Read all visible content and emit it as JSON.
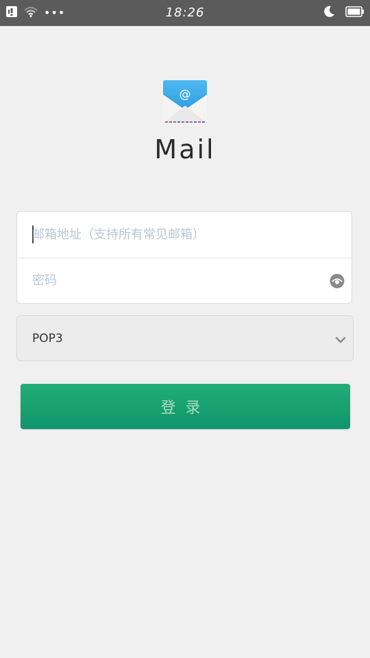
{
  "status_bar": {
    "time": "18:26",
    "dots": "•••",
    "icons": [
      "notification-icon",
      "wifi-icon",
      "more-dots-icon",
      "moon-icon",
      "battery-icon"
    ]
  },
  "app": {
    "icon": "mail-envelope-icon",
    "title": "Mail"
  },
  "form": {
    "email_placeholder": "邮箱地址（支持所有常见邮箱）",
    "email_value": "",
    "password_placeholder": "密码",
    "password_value": "",
    "show_password_icon": "eye-icon"
  },
  "protocol": {
    "selected": "POP3",
    "icon": "chevron-down-icon"
  },
  "login_button": {
    "label": "登录"
  },
  "colors": {
    "status_bar": "#5b5b5b",
    "background": "#f0f0f0",
    "button_green": "#16a06f",
    "placeholder": "#b9c6d3"
  }
}
